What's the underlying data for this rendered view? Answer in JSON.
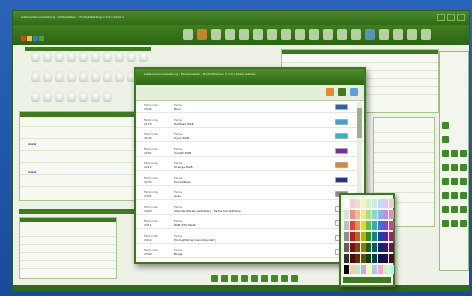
{
  "window": {
    "title": "Lieferantenverwaltung - Artikeldaten - Produktkatalog V 2.0 | Seite 1",
    "logo_colors": [
      "#e63b2e",
      "#f2c230",
      "#3a78d8",
      "#3ea83a"
    ]
  },
  "toolbar": {
    "buttons": [
      "new",
      "open",
      "save",
      "print",
      "copy",
      "paste",
      "undo",
      "redo",
      "search",
      "filter",
      "export",
      "import",
      "settings",
      "help",
      "info",
      "mail",
      "refresh",
      "close"
    ]
  },
  "dialog": {
    "title": "Lieferantenverwaltung - Farbauswahl - Produktfarben V 2.0 | Farbe wählen",
    "rows": [
      {
        "code": "Farbcode",
        "value": "2044",
        "label": "Farbe",
        "name": "Blau",
        "color": "#2f5fb5"
      },
      {
        "code": "Farbcode",
        "value": "2123",
        "label": "Farbe",
        "name": "Hellblau RGB",
        "color": "#35a6d6"
      },
      {
        "code": "Farbcode",
        "value": "2145",
        "label": "Farbe",
        "name": "Cyan RGB",
        "color": "#2cb8c0"
      },
      {
        "code": "Farbcode",
        "value": "2201",
        "label": "Farbe",
        "name": "Violett RGB",
        "color": "#7b2f9e"
      },
      {
        "code": "Farbcode",
        "value": "2212",
        "label": "Farbe",
        "name": "Orange RGB",
        "color": "#e8812a"
      },
      {
        "code": "Farbcode",
        "value": "2230",
        "label": "Farbe",
        "name": "Dunkelblau",
        "color": "#23338a"
      },
      {
        "code": "Farbcode",
        "value": "2301",
        "label": "Farbe",
        "name": "Grau",
        "color": "#8c8c8c"
      },
      {
        "code": "Farbcode",
        "value": "2400",
        "label": "Farbe",
        "name": "Standardfarbe (wählbar) - Farbe frei wählbar",
        "color": "#ffffff"
      },
      {
        "code": "Farbcode",
        "value": "2411",
        "label": "Farbe",
        "name": "RGB 255 Weiß",
        "color": "#f4f4f4"
      },
      {
        "code": "Farbcode",
        "value": "2412",
        "label": "Farbe",
        "name": "Produktfarbe (benutzerdef.)",
        "color": "#ffffff"
      },
      {
        "code": "Farbcode",
        "value": "2500",
        "label": "Farbe",
        "name": "Beige",
        "color": "#ffffff"
      }
    ]
  },
  "palette": {
    "colors": [
      "#ffffff",
      "#f0d0d0",
      "#f4e0c0",
      "#f8f4c0",
      "#d8f0c0",
      "#c8ecec",
      "#c8d8f8",
      "#e0c8f0",
      "#f0c8e0",
      "#e0e0e0",
      "#e89090",
      "#f0c080",
      "#f0e880",
      "#a8e080",
      "#80d8d8",
      "#90b0f0",
      "#c090e0",
      "#e090c0",
      "#c0c0c0",
      "#e04040",
      "#f09030",
      "#e8d820",
      "#60c040",
      "#30b0b0",
      "#4070e0",
      "#9040d0",
      "#d040a0",
      "#909090",
      "#b02020",
      "#c86010",
      "#c0b000",
      "#309020",
      "#108888",
      "#2040b0",
      "#6020a0",
      "#a02070",
      "#606060",
      "#801010",
      "#904000",
      "#908000",
      "#206010",
      "#006060",
      "#102080",
      "#401070",
      "#701050",
      "#303030",
      "#500808",
      "#602800",
      "#605000",
      "#104008",
      "#004040",
      "#081050",
      "#280848",
      "#480830",
      "#000000",
      "#f8c8a8",
      "#a8f0c8",
      "#c8a8f0",
      "#f8f8a8",
      "#a8c8f8",
      "#f8a8c8",
      "#c8f8a8",
      "#a8f8f8"
    ]
  }
}
